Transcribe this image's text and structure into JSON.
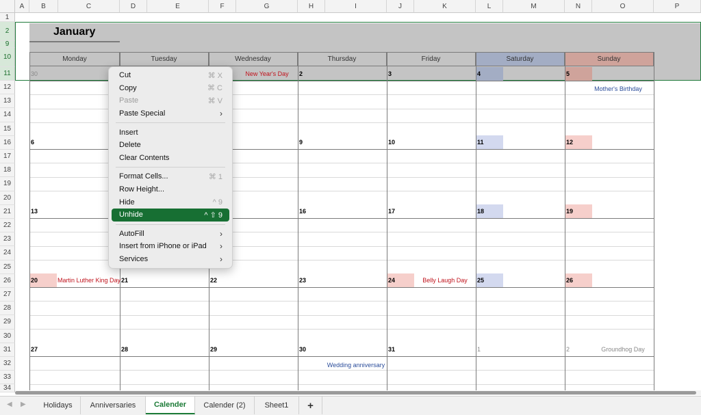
{
  "sheet": {
    "columns": [
      "A",
      "B",
      "C",
      "D",
      "E",
      "F",
      "G",
      "H",
      "I",
      "J",
      "K",
      "L",
      "M",
      "N",
      "O",
      "P"
    ],
    "rows": [
      "1",
      "2",
      "9",
      "10",
      "11",
      "12",
      "13",
      "14",
      "15",
      "16",
      "17",
      "18",
      "19",
      "20",
      "21",
      "22",
      "23",
      "24",
      "25",
      "26",
      "27",
      "28",
      "29",
      "30",
      "31",
      "32",
      "33",
      "34"
    ]
  },
  "calendar": {
    "month": "January",
    "weekdays": [
      "Monday",
      "Tuesday",
      "Wednesday",
      "Thursday",
      "Friday",
      "Saturday",
      "Sunday"
    ],
    "weeks": [
      [
        "30",
        "",
        "",
        "2",
        "3",
        "4",
        "5"
      ],
      [
        "6",
        "",
        "",
        "9",
        "10",
        "11",
        "12"
      ],
      [
        "13",
        "",
        "",
        "16",
        "17",
        "18",
        "19"
      ],
      [
        "20",
        "21",
        "22",
        "23",
        "24",
        "25",
        "26"
      ],
      [
        "27",
        "28",
        "29",
        "30",
        "31",
        "1",
        "2"
      ]
    ],
    "events": {
      "new_years": "New Year's Day",
      "mothers_birthday": "Mother's Birthday",
      "mlk": "Martin Luther King Day",
      "belly_laugh": "Belly Laugh Day",
      "wedding": "Wedding anniversary",
      "groundhog": "Groundhog Day"
    },
    "colors": {
      "saturday": "#a3adc4",
      "sunday": "#cfa39b",
      "red_event": "#c0121b",
      "blue_event": "#2a4c9a",
      "sat_shade": "#d3d9ef",
      "sun_shade": "#f6cfcb"
    }
  },
  "context_menu": {
    "items": [
      {
        "label": "Cut",
        "shortcut": "⌘ X"
      },
      {
        "label": "Copy",
        "shortcut": "⌘ C"
      },
      {
        "label": "Paste",
        "shortcut": "⌘ V"
      },
      {
        "label": "Paste Special",
        "shortcut": "›"
      },
      {
        "label": "Insert"
      },
      {
        "label": "Delete"
      },
      {
        "label": "Clear Contents"
      },
      {
        "label": "Format Cells...",
        "shortcut": "⌘ 1"
      },
      {
        "label": "Row Height..."
      },
      {
        "label": "Hide",
        "shortcut": "^ 9"
      },
      {
        "label": "Unhide",
        "shortcut": "^ ⇧ 9"
      },
      {
        "label": "AutoFill",
        "shortcut": "›"
      },
      {
        "label": "Insert from iPhone or iPad",
        "shortcut": "›"
      },
      {
        "label": "Services",
        "shortcut": "›"
      }
    ]
  },
  "tabs": [
    "Holidays",
    "Anniversaries",
    "Calender",
    "Calender (2)",
    "Sheet1",
    "+"
  ],
  "active_tab": "Calender"
}
